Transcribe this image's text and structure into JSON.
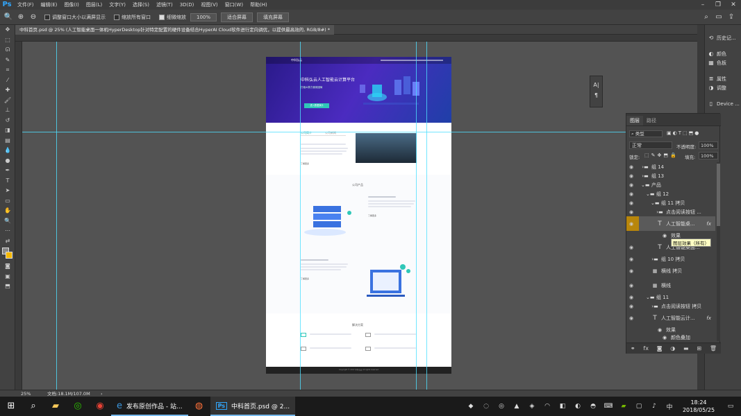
{
  "app": {
    "logo": "Ps"
  },
  "menu": [
    "文件(F)",
    "编辑(E)",
    "图像(I)",
    "图层(L)",
    "文字(Y)",
    "选择(S)",
    "滤镜(T)",
    "3D(D)",
    "视图(V)",
    "窗口(W)",
    "帮助(H)"
  ],
  "options": {
    "resize_label": "调整窗口大小以满屏显示",
    "zoom_all_label": "缩放所有窗口",
    "scrubby_label": "细微缩放",
    "zoom_value": "100%",
    "fit_screen": "适合屏幕",
    "fill_screen": "填充屏幕"
  },
  "document_tab": "中科首页.psd @ 25% (人工智能桌面一体机HyperDesktop针对特定配置的硬件设备结合HyperAI Cloud软件进行定向调优，以提供最高效的, RGB/8#) *",
  "design": {
    "logo": "中科弘云",
    "hero_title": "中科弘云人工智能云计算平台",
    "hero_sub": "打破AI算力使用困局",
    "hero_button": "进入数据演示",
    "tab_intro": "公司简介",
    "tab_news": "公司新闻",
    "products_title": "公司产品",
    "solutions_title": "解决方案",
    "learn_more": "了解更多",
    "footer": "Copyright © 2017 中科弘云 All rights reserved"
  },
  "dock": [
    {
      "icon": "history-icon",
      "label": "历史记..."
    },
    {
      "icon": "color-icon",
      "label": "颜色"
    },
    {
      "icon": "swatches-icon",
      "label": "色板"
    },
    {
      "icon": "properties-icon",
      "label": "属性"
    },
    {
      "icon": "adjust-icon",
      "label": "调整"
    },
    {
      "icon": "device-icon",
      "label": "Device ..."
    }
  ],
  "layers_panel": {
    "tab_layers": "图层",
    "tab_paths": "路径",
    "filter_kind": "类型",
    "blend_mode": "正常",
    "opacity_label": "不透明度:",
    "opacity": "100%",
    "lock_label": "锁定:",
    "fill_label": "填充:",
    "fill": "100%",
    "tooltip": "图层效果（所有）",
    "rows": [
      {
        "name": "组 14",
        "kind": "folder",
        "indent": 1
      },
      {
        "name": "组 13",
        "kind": "folder",
        "indent": 1
      },
      {
        "name": "产品",
        "kind": "folder-open",
        "indent": 1
      },
      {
        "name": "组 12",
        "kind": "folder-open",
        "indent": 2
      },
      {
        "name": "组 11 拷贝",
        "kind": "folder-open",
        "indent": 3
      },
      {
        "name": "点击阅读按钮 ...",
        "kind": "folder",
        "indent": 4
      },
      {
        "name": "人工智能桌...",
        "kind": "text",
        "indent": 4,
        "fx": true,
        "selected": true
      },
      {
        "name": "效果",
        "kind": "effect",
        "indent": 5
      },
      {
        "name": "人工智能桌面...",
        "kind": "text",
        "indent": 4
      },
      {
        "name": "组 10 拷贝",
        "kind": "folder",
        "indent": 3
      },
      {
        "name": "横线 拷贝",
        "kind": "shape",
        "indent": 3
      },
      {
        "name": "横线",
        "kind": "shape",
        "indent": 3
      },
      {
        "name": "组 11",
        "kind": "folder-open",
        "indent": 2
      },
      {
        "name": "点击阅读按钮 拷贝",
        "kind": "folder",
        "indent": 3
      },
      {
        "name": "人工智能云计...",
        "kind": "text",
        "indent": 3,
        "fx": true
      },
      {
        "name": "效果",
        "kind": "effect",
        "indent": 4
      },
      {
        "name": "颜色叠加",
        "kind": "effect",
        "indent": 5
      }
    ]
  },
  "status": {
    "zoom": "25%",
    "doc": "文档:18.1M/107.0M"
  },
  "taskbar": {
    "apps": [
      "发布原创作品 - 站...",
      "中科首页.psd @ 2..."
    ],
    "time": "18:24",
    "date": "2018/05/25",
    "ime": "中"
  },
  "colors": {
    "accent": "#31a8ff",
    "guide": "#4ee0ff",
    "hero_purple": "#4b2bc0",
    "teal": "#2fc7b8"
  }
}
